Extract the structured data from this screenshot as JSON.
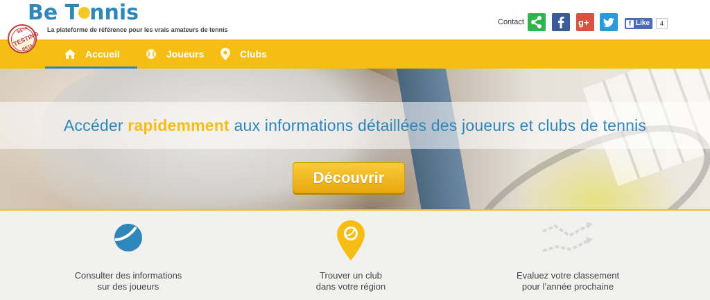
{
  "header": {
    "logo_prefix": "Be T",
    "logo_suffix": "nnis",
    "tagline": "La plateforme de référence pour les vrais amateurs de tennis",
    "stamp": {
      "main": "TESTING",
      "top": "BETA",
      "bottom": "BETA"
    },
    "contact_label": "Contact",
    "social": [
      {
        "name": "share-icon",
        "color": "#2fb550"
      },
      {
        "name": "facebook-icon",
        "color": "#3a5a98"
      },
      {
        "name": "google-plus-icon",
        "color": "#d9513f"
      },
      {
        "name": "twitter-icon",
        "color": "#2a9bd8"
      }
    ],
    "fb_like_label": "Like",
    "fb_like_count": "4"
  },
  "nav": {
    "items": [
      {
        "label": "Accueil",
        "icon": "home-icon",
        "active": true
      },
      {
        "label": "Joueurs",
        "icon": "tennis-ball-icon",
        "active": false
      },
      {
        "label": "Clubs",
        "icon": "map-pin-icon",
        "active": false
      }
    ]
  },
  "hero": {
    "title_before": "Accéder ",
    "title_highlight": "rapidemment",
    "title_after": " aux informations détaillées des joueurs et clubs de tennis",
    "cta_label": "Découvrir"
  },
  "features": [
    {
      "icon": "tennis-ball-icon",
      "line1": "Consulter des informations",
      "line2": "sur des joueurs"
    },
    {
      "icon": "club-location-pin-icon",
      "line1": "Trouver un club",
      "line2": "dans votre région"
    },
    {
      "icon": "trend-chart-icon",
      "line1": "Evaluez votre classement",
      "line2": "pour l’année prochaine"
    }
  ],
  "colors": {
    "brand_blue": "#2f86b9",
    "brand_yellow": "#f6be13"
  }
}
